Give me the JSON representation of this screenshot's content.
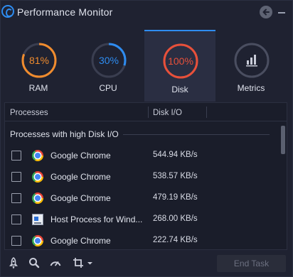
{
  "app": {
    "title": "Performance Monitor"
  },
  "colors": {
    "ram": "#f08c2e",
    "cpu": "#2e8cf0",
    "disk": "#e8503a",
    "metrics": "#c9ccd8",
    "accent": "#2e8cf0"
  },
  "gauges": [
    {
      "label": "RAM",
      "value_text": "81%",
      "value": 81
    },
    {
      "label": "CPU",
      "value_text": "30%",
      "value": 30
    },
    {
      "label": "Disk",
      "value_text": "100%",
      "value": 100,
      "selected": true
    },
    {
      "label": "Metrics",
      "icon": "bar-chart-icon"
    }
  ],
  "table": {
    "columns": [
      "Processes",
      "Disk I/O"
    ],
    "group_label": "Processes with high Disk I/O",
    "rows": [
      {
        "name": "Google Chrome",
        "value": "544.94 KB/s",
        "icon": "chrome-icon"
      },
      {
        "name": "Google Chrome",
        "value": "538.57 KB/s",
        "icon": "chrome-icon"
      },
      {
        "name": "Google Chrome",
        "value": "479.19 KB/s",
        "icon": "chrome-icon"
      },
      {
        "name": "Host Process for Wind...",
        "value": "268.00 KB/s",
        "icon": "host-process-icon"
      },
      {
        "name": "Google Chrome",
        "value": "222.74 KB/s",
        "icon": "chrome-icon"
      }
    ]
  },
  "bottombar": {
    "icons": [
      "rocket-icon",
      "search-icon",
      "speedometer-icon",
      "crop-icon"
    ],
    "end_task_label": "End Task"
  }
}
